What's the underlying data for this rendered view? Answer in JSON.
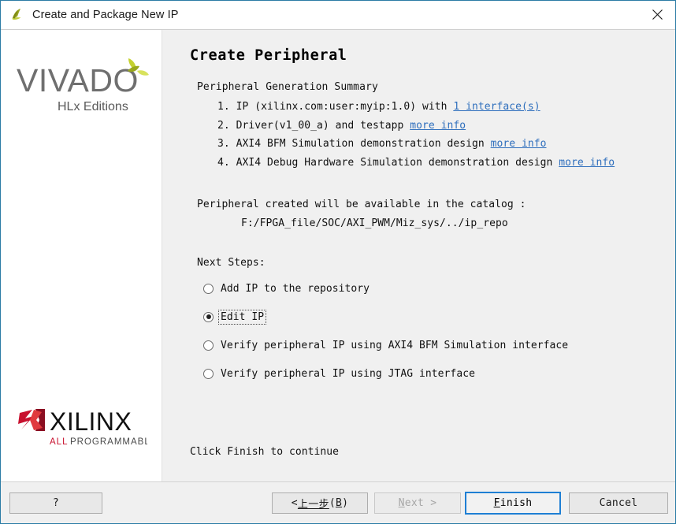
{
  "window": {
    "title": "Create and Package New IP",
    "icon": "vivado-leaf-icon",
    "close_icon": "close-icon"
  },
  "sidebar": {
    "vivado_logo": {
      "wordmark": "VIVADO",
      "dot": ".",
      "subtitle": "HLx Editions"
    },
    "xilinx_logo": {
      "wordmark": "XILINX",
      "tagline_accent": "ALL",
      "tagline_rest": "PROGRAMMABLE."
    }
  },
  "content": {
    "page_title": "Create Peripheral",
    "summary_heading": "Peripheral Generation Summary",
    "summary_items": [
      {
        "number": "1.",
        "text_before": "IP (xilinx.com:user:myip:1.0) with ",
        "link": "1 interface(s)",
        "text_after": ""
      },
      {
        "number": "2.",
        "text_before": "Driver(v1_00_a) and testapp ",
        "link": "more info",
        "text_after": ""
      },
      {
        "number": "3.",
        "text_before": "AXI4 BFM Simulation demonstration design ",
        "link": "more info",
        "text_after": ""
      },
      {
        "number": "4.",
        "text_before": "AXI4 Debug Hardware Simulation demonstration design ",
        "link": "more info",
        "text_after": ""
      }
    ],
    "catalog_line": "Peripheral created will be available in the catalog :",
    "catalog_path": "F:/FPGA_file/SOC/AXI_PWM/Miz_sys/../ip_repo",
    "next_steps_label": "Next Steps:",
    "radio_options": [
      {
        "label": "Add IP to the repository",
        "checked": false,
        "focused": false
      },
      {
        "label": "Edit IP",
        "checked": true,
        "focused": true
      },
      {
        "label": "Verify peripheral IP using AXI4 BFM Simulation interface",
        "checked": false,
        "focused": false
      },
      {
        "label": "Verify peripheral IP using JTAG interface",
        "checked": false,
        "focused": false
      }
    ],
    "finish_hint": "Click Finish to continue"
  },
  "footer": {
    "help_label": "?",
    "back_label_prefix": "< ",
    "back_label_text": "上一步",
    "back_label_mnemonic_open": "(",
    "back_label_mnemonic": "B",
    "back_label_mnemonic_close": ")",
    "next_label_mnemonic": "N",
    "next_label_rest": "ext >",
    "finish_label_mnemonic": "F",
    "finish_label_rest": "inish",
    "cancel_label": "Cancel"
  },
  "colors": {
    "accent_border": "#2b7ca5",
    "link": "#2f6fbd",
    "default_button_border": "#1e7fd4",
    "content_bg": "#f0f0f0",
    "sidebar_bg": "#ffffff",
    "xilinx_red": "#c8102e",
    "vivado_green": "#b5c334"
  }
}
